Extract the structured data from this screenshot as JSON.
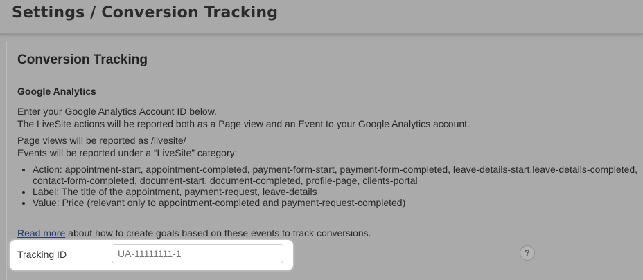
{
  "header": {
    "title": "Settings / Conversion Tracking"
  },
  "section": {
    "title": "Conversion Tracking",
    "subtitle": "Google Analytics",
    "intro_line1": "Enter your Google Analytics Account ID below.",
    "intro_line2": "The LiveSite actions will be reported both as a Page view and an Event to your Google Analytics account.",
    "pageviews_line1": "Page views will be reported as /livesite/",
    "pageviews_line2": "Events will be reported under a “LiveSite” category:",
    "bullets": [
      "Action: appointment-start, appointment-completed, payment-form-start, payment-form-completed, leave-details-start,leave-details-completed, contact-form-completed, document-start, document-completed, profile-page, clients-portal",
      "Label: The title of the appointment, payment-request, leave-details",
      "Value: Price (relevant only to appointment-completed and payment-request-completed)"
    ],
    "read_more_link": "Read more",
    "read_more_rest": " about how to create goals based on these events to track conversions."
  },
  "tracking": {
    "label": "Tracking ID",
    "placeholder": "UA-11111111-1",
    "value": ""
  },
  "help": {
    "icon": "help-icon",
    "glyph": "?"
  }
}
